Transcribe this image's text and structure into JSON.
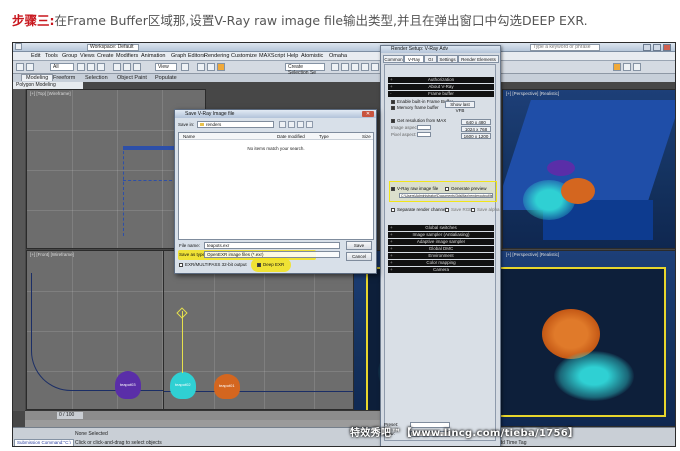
{
  "caption": {
    "lead": "步骤三:",
    "text": "在Frame Buffer区域那,设置V-Ray raw image file输出类型,并且在弹出窗口中勾选DEEP EXR."
  },
  "app": {
    "workspace": "Workspace: Default",
    "search_placeholder": "Type a keyword or phrase"
  },
  "menu": [
    "Edit",
    "Tools",
    "Group",
    "Views",
    "Create",
    "Modifiers",
    "Animation",
    "Graph Editors",
    "Rendering",
    "Customize",
    "MAXScript",
    "Help",
    "Atomistic",
    "Omaha"
  ],
  "toolbar": {
    "filter": "All",
    "view": "View",
    "selection_set": "Create Selection Se"
  },
  "ribbon": {
    "tabs": [
      "Modeling",
      "Freeform",
      "Selection",
      "Object Paint",
      "Populate"
    ],
    "sub": "Polygon Modeling"
  },
  "viewports": [
    {
      "label": "[+] [Top] [Wireframe]"
    },
    {
      "label": "[+] [Perspective] [Realistic]"
    },
    {
      "label": "[+] [Front] [Wireframe]"
    },
    {
      "label": "[+] [Perspective] [Realistic]"
    }
  ],
  "timeline": {
    "frame": "0 / 100"
  },
  "status": {
    "script": "Submission Command:\"C:\\",
    "selection": "None Selected",
    "hint": "Click or click-and-drag to select objects",
    "add_tag": "Add Time Tag"
  },
  "render_setup": {
    "title": "Render Setup: V-Ray Adv",
    "tabs": [
      "Common",
      "V-Ray",
      "GI",
      "Settings",
      "Render Elements"
    ],
    "rollouts_top": [
      "Authorization",
      "About V-Ray",
      "Frame buffer"
    ],
    "enable_vfb": "Enable built-in Frame Buffer",
    "memory_fb": "Memory frame buffer",
    "show_last_vfb": "Show last VFB",
    "get_resolution": "Get resolution from MAX",
    "image_aspect": "Image aspect:",
    "pixel_aspect": "Pixel aspect:",
    "width": "640",
    "height": "480",
    "res_buttons": [
      "640 x 480",
      "1024 x 768",
      "1600 x 1200"
    ],
    "raw_image": "V-Ray raw image file",
    "generate_preview": "Generate preview",
    "raw_path": "C:\\Users\\Administrator\\Documents\\3dsMax\\renderoutput\\teapots.exr",
    "separate_channels": "Separate render channels",
    "save_rgb": "Save RGB",
    "save_alpha": "Save alpha",
    "rollouts_bottom": [
      "Global switches",
      "Image sampler (Antialiasing)",
      "Adaptive image sampler",
      "Global DMC",
      "Environment",
      "Color mapping",
      "Camera"
    ],
    "preset_label": "Preset:",
    "view_label": "View:"
  },
  "save_dialog": {
    "title": "Save V-Ray Image file",
    "save_in_label": "Save in:",
    "folder": "renders",
    "columns": [
      "Name",
      "Date modified",
      "Type",
      "Size"
    ],
    "empty_text": "No items match your search.",
    "filename_label": "File name:",
    "filename": "teapots.exr",
    "type_label": "Save as type:",
    "type_value": "OpenEXR image files (*.exr)",
    "save_button": "Save",
    "cancel_button": "Cancel",
    "exr_option": "EXR/MULTIPASS 32-bit output",
    "deep_exr": "Deep EXR"
  },
  "scene_labels": [
    "teapot03",
    "teapot02",
    "teapot01"
  ],
  "watermark": "特效秀吧™【www.lincg.com/tieba/1756】",
  "colors": {
    "highlight": "#f3e215",
    "caption_red": "#c8161d",
    "teapot_purple": "#5a2ea8",
    "teapot_cyan": "#2fd0d3",
    "teapot_orange": "#d4661f"
  }
}
